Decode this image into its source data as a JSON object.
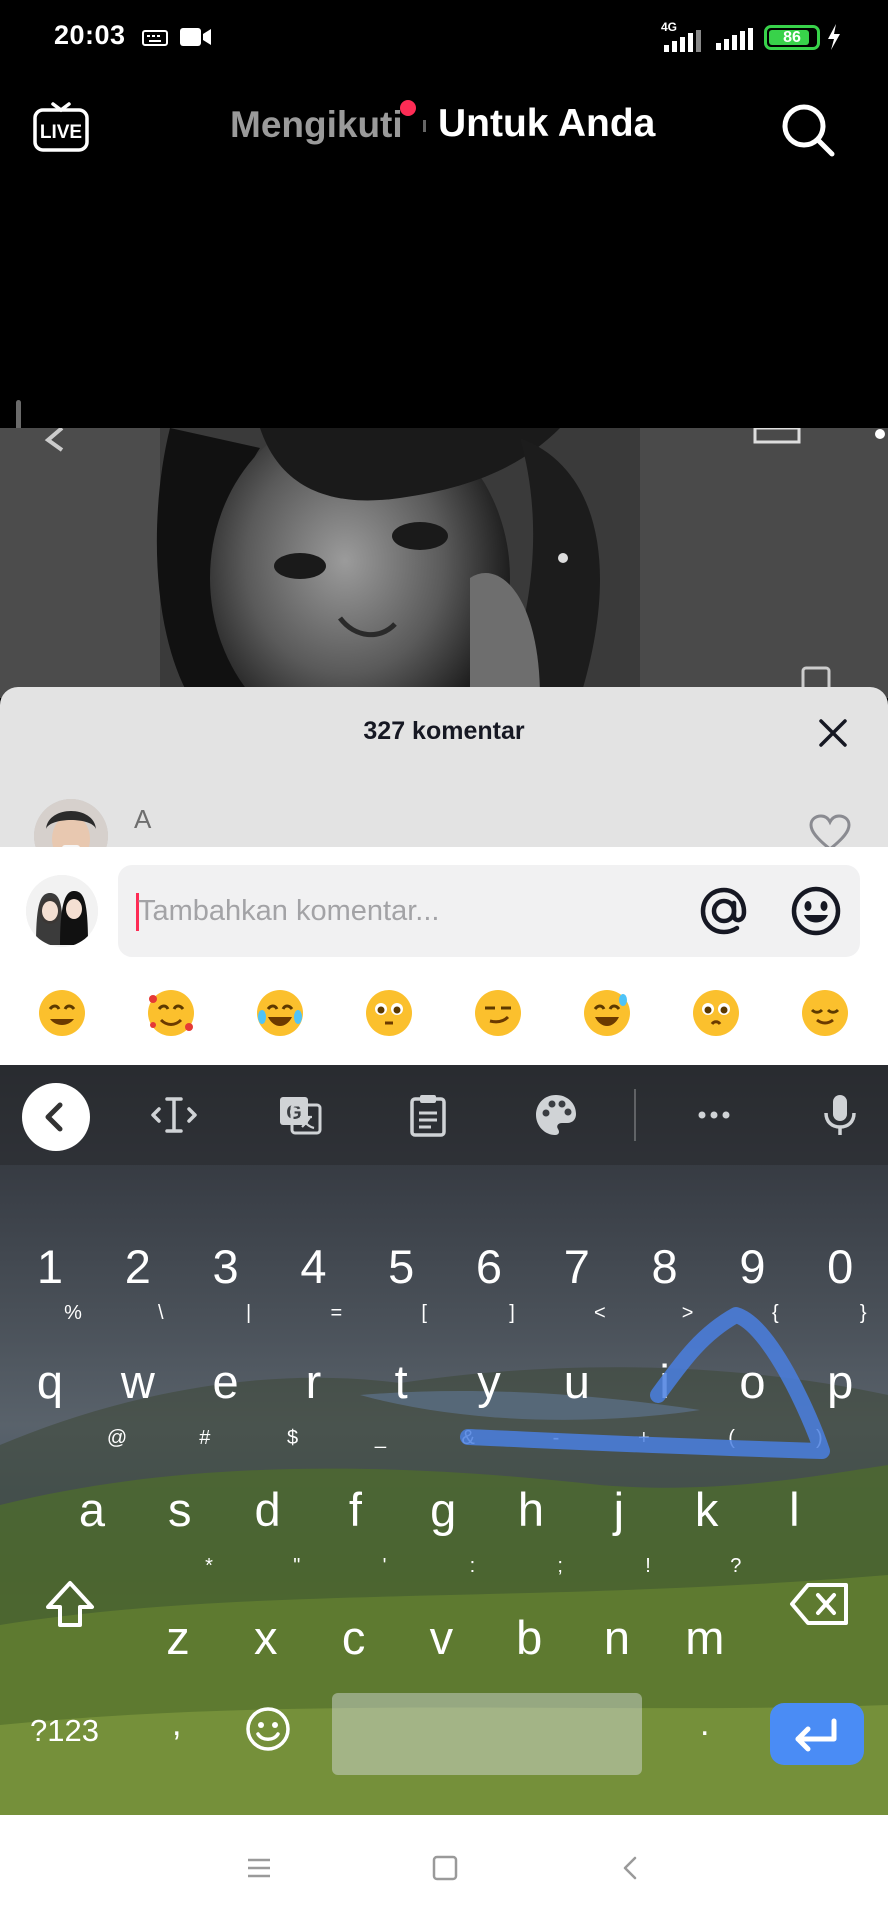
{
  "status_bar": {
    "time": "20:03",
    "network": "4G",
    "battery": "86",
    "battery_level": 0.86
  },
  "top_nav": {
    "live_label": "LIVE",
    "following_label": "Mengikuti",
    "for_you_label": "Untuk Anda"
  },
  "comments": {
    "count_label": "327 komentar",
    "first_author": "A"
  },
  "compose": {
    "placeholder": "Tambahkan komentar...",
    "quick_emojis": [
      {
        "icon": "grinning-emoji"
      },
      {
        "icon": "smiling-face-hearts-emoji"
      },
      {
        "icon": "tears-of-joy-emoji"
      },
      {
        "icon": "flushed-emoji"
      },
      {
        "icon": "smirk-emoji"
      },
      {
        "icon": "sweat-smile-emoji"
      },
      {
        "icon": "pleading-emoji"
      },
      {
        "icon": "relieved-emoji"
      }
    ]
  },
  "keyboard": {
    "number_row": [
      "1",
      "2",
      "3",
      "4",
      "5",
      "6",
      "7",
      "8",
      "9",
      "0"
    ],
    "row1": [
      "q",
      "w",
      "e",
      "r",
      "t",
      "y",
      "u",
      "i",
      "o",
      "p"
    ],
    "row1_hints": [
      "%",
      "\\",
      "|",
      "=",
      "[",
      "]",
      "<",
      ">",
      "{",
      "}"
    ],
    "row2": [
      "a",
      "s",
      "d",
      "f",
      "g",
      "h",
      "j",
      "k",
      "l"
    ],
    "row2_hints": [
      "@",
      "#",
      "$",
      "_",
      "&",
      "-",
      "+",
      "(",
      ")"
    ],
    "row3": [
      "z",
      "x",
      "c",
      "v",
      "b",
      "n",
      "m"
    ],
    "row3_hints": [
      "*",
      "\"",
      "'",
      ":",
      ";",
      "!",
      "?"
    ],
    "symbols_label": "?123",
    "comma_label": ",",
    "period_label": ".",
    "accent_color": "#4a8cf5"
  },
  "colors": {
    "brand": "#fe2c55",
    "battery": "#38d24a"
  }
}
